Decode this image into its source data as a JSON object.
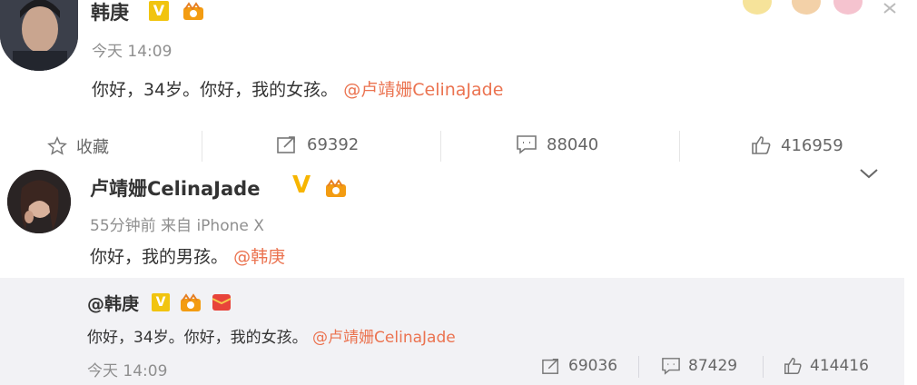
{
  "post1": {
    "author": "韩庚",
    "time": "今天 14:09",
    "text": "你好，34岁。你好，我的女孩。",
    "mention": "@卢靖姗CelinaJade",
    "actions": {
      "favorite_label": "收藏",
      "repost_count": "69392",
      "comment_count": "88040",
      "like_count": "416959"
    }
  },
  "post2": {
    "author": "卢靖姗CelinaJade",
    "time_source": "55分钟前 来自 iPhone X",
    "text": "你好，我的男孩。",
    "mention": "@韩庚",
    "quoted": {
      "author": "@韩庚",
      "text": "你好，34岁。你好，我的女孩。",
      "mention": "@卢靖姗CelinaJade",
      "time": "今天 14:09",
      "repost_count": "69036",
      "comment_count": "87429",
      "like_count": "414416"
    }
  },
  "icons": {
    "verified": "V",
    "vip": "vip-crown-icon"
  },
  "colors": {
    "mention": "#eb7350",
    "verified": "#f7b500",
    "quote_bg": "#f2f2f5"
  }
}
